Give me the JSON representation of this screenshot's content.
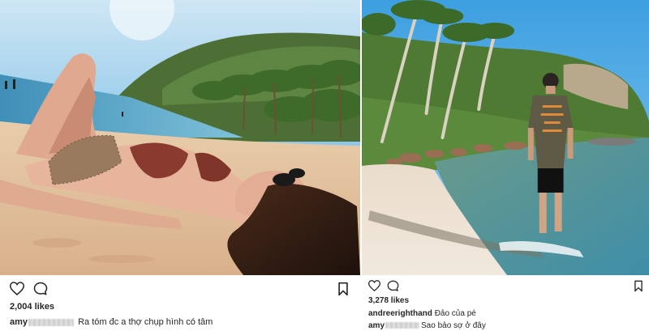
{
  "posts": [
    {
      "likes": "2,004 likes",
      "comments": [
        {
          "username": "amy",
          "text": "Ra tóm đc a thợ chụp hình có tâm"
        }
      ]
    },
    {
      "likes": "3,278 likes",
      "comments": [
        {
          "username": "andreerighthand",
          "text": "Đảo của pé"
        },
        {
          "username": "amy",
          "text": "Sao bảo sợ ở đây"
        }
      ]
    }
  ],
  "icons": {
    "like": "heart-icon",
    "comment": "speech-bubble-icon",
    "save": "bookmark-icon"
  },
  "colors": {
    "text": "#262626",
    "sky": "#7fc6ea",
    "sea": "#5aa7c4",
    "sand": "#e6c7a4",
    "foliage": "#4f7a34"
  }
}
